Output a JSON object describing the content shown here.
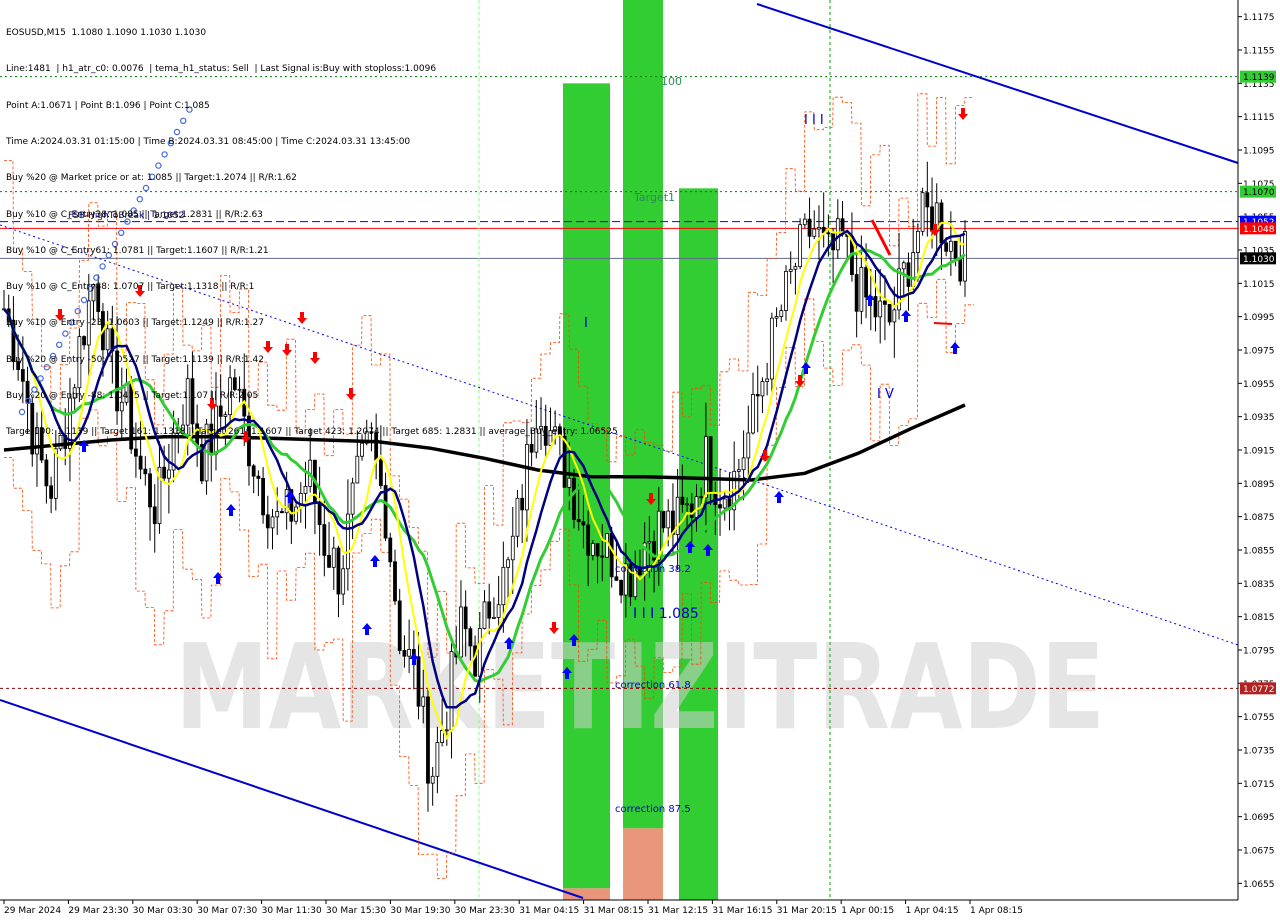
{
  "header": {
    "symbol_line": "EOSUSD,M15  1.1080 1.1090 1.1030 1.1030",
    "info_lines": [
      "Line:1481  | h1_atr_c0: 0.0076  | tema_h1_status: Sell  | Last Signal is:Buy with stoploss:1.0096",
      "Point A:1.0671 | Point B:1.096 | Point C:1.085",
      "Time A:2024.03.31 01:15:00 | Time B:2024.03.31 08:45:00 | Time C:2024.03.31 13:45:00",
      "Buy %20 @ Market price or at: 1.085 || Target:1.2074 || R/R:1.62",
      "Buy %10 @ C_Entry38: 1.085 || Target:1.2831 || R/R:2.63",
      "Buy %10 @ C_Entry61: 1.0781 || Target:1.1607 || R/R:1.21",
      "Buy %10 @ C_Entry88: 1.0707 || Target:1.1318 || R/R:1",
      "Buy %10 @ Entry -23: 1.0603 || Target:1.1249 || R/R:1.27",
      "Buy %20 @ Entry -50: 1.0527 || Target:1.1139 || R/R:1.42",
      "Buy %20 @ Entry -88: 1.0415 || Target:1.107 || R/R:2.05",
      "Target100: 1.1139 || Target 161: 1.1318 || Target 261: 1.1607 || Target 423: 1.2074 || Target 685: 1.2831 || average_Buy_entry: 1.06525"
    ]
  },
  "colors": {
    "background": "#ffffff",
    "candle": "#000000",
    "ma_black": "#000000",
    "ma_navy": "#000080",
    "ma_green": "#32cd32",
    "ma_yellow": "#ffff00",
    "channel": "#0000cd",
    "zone_green": "#32cd32",
    "zone_orange": "#e9967a",
    "dotted_green": "#008000",
    "price_label_green": "#32cd32",
    "price_label_blue": "#0000ff",
    "price_label_red": "#ff0000",
    "price_label_dark": "#000000",
    "label_dark_red": "#b22222",
    "arrow_up": "#0000ff",
    "arrow_down": "#ff0000",
    "orange_line": "#ff4500",
    "watermark": "#d0d0d0"
  },
  "price_axis": {
    "ticks": [
      "1.1175",
      "1.1155",
      "1.1135",
      "1.1115",
      "1.1095",
      "1.1075",
      "1.1055",
      "1.1035",
      "1.1015",
      "1.0995",
      "1.0975",
      "1.0955",
      "1.0935",
      "1.0915",
      "1.0895",
      "1.0875",
      "1.0855",
      "1.0835",
      "1.0815",
      "1.0795",
      "1.0775",
      "1.0755",
      "1.0735",
      "1.0715",
      "1.0695",
      "1.0675",
      "1.0655"
    ]
  },
  "time_axis": {
    "labels": [
      "29 Mar 2024",
      "29 Mar 23:30",
      "30 Mar 03:30",
      "30 Mar 07:30",
      "30 Mar 11:30",
      "30 Mar 15:30",
      "30 Mar 19:30",
      "30 Mar 23:30",
      "31 Mar 04:15",
      "31 Mar 08:15",
      "31 Mar 12:15",
      "31 Mar 16:15",
      "31 Mar 20:15",
      "1 Apr 00:15",
      "1 Apr 04:15",
      "1 Apr 08:15"
    ]
  },
  "price_labels": [
    {
      "value": "1.1139",
      "style": "green"
    },
    {
      "value": "1.1070",
      "style": "green"
    },
    {
      "value": "1.1052",
      "style": "blue"
    },
    {
      "value": "1.1048",
      "style": "red"
    },
    {
      "value": "1.1030",
      "style": "dark"
    },
    {
      "value": "1.0772",
      "style": "darkred"
    }
  ],
  "levels": [
    {
      "price": 1.1139,
      "style": "dotted_green"
    },
    {
      "price": 1.107,
      "style": "dotted_green"
    },
    {
      "price": 1.1052,
      "style": "dashed_blue"
    },
    {
      "price": 1.1048,
      "style": "solid_red"
    },
    {
      "price": 1.103,
      "style": "solid_slate"
    },
    {
      "price": 1.0772,
      "style": "dotted_darkred"
    }
  ],
  "annotations": {
    "fsb_label": "FSB-HighToBreak | 1.1052",
    "target1": "Target1",
    "hundred": "100",
    "wave_iii": "I I I",
    "wave_i": "I",
    "wave_iv": "I V",
    "wave_iii_price": "I I I 1.085",
    "correction_38": "correction 38.2",
    "correction_61": "correction 61.8",
    "correction_87": "correction 87.5",
    "watermark": "MARKETIZITRADE"
  },
  "chart_data": {
    "type": "candlestick",
    "symbol": "EOSUSD",
    "timeframe": "M15",
    "ohlc_last": {
      "open": 1.108,
      "high": 1.109,
      "low": 1.103,
      "close": 1.103
    },
    "ylim": [
      1.0645,
      1.1185
    ],
    "grid": false,
    "x_categories": [
      "29 Mar 2024",
      "29 Mar 23:30",
      "30 Mar 03:30",
      "30 Mar 07:30",
      "30 Mar 11:30",
      "30 Mar 15:30",
      "30 Mar 19:30",
      "30 Mar 23:30",
      "31 Mar 04:15",
      "31 Mar 08:15",
      "31 Mar 12:15",
      "31 Mar 16:15",
      "31 Mar 20:15",
      "1 Apr 00:15",
      "1 Apr 04:15",
      "1 Apr 08:15"
    ],
    "close_path": [
      1.1,
      1.097,
      1.092,
      1.089,
      1.093,
      1.098,
      1.102,
      1.096,
      1.094,
      1.09,
      1.088,
      1.092,
      1.095,
      1.091,
      1.093,
      1.096,
      1.092,
      1.089,
      1.087,
      1.088,
      1.09,
      1.086,
      1.084,
      1.089,
      1.092,
      1.088,
      1.08,
      1.078,
      1.072,
      1.076,
      1.081,
      1.079,
      1.083,
      1.084,
      1.089,
      1.095,
      1.092,
      1.09,
      1.087,
      1.086,
      1.085,
      1.084,
      1.086,
      1.087,
      1.087,
      1.088,
      1.091,
      1.089,
      1.09,
      1.093,
      1.097,
      1.1,
      1.103,
      1.105,
      1.103,
      1.104,
      1.101,
      1.1,
      1.099,
      1.102,
      1.105,
      1.106,
      1.104,
      1.103
    ],
    "sma_long": [
      1.0915,
      1.0918,
      1.0921,
      1.0923,
      1.0923,
      1.0922,
      1.0921,
      1.092,
      1.0916,
      1.091,
      1.0903,
      1.0899,
      1.0899,
      1.0898,
      1.0897,
      1.0901,
      1.0913,
      1.0928,
      1.0942
    ],
    "levels": [
      1.1139,
      1.107,
      1.1052,
      1.1048,
      1.103,
      1.0772
    ],
    "points": {
      "A": 1.0671,
      "B": 1.096,
      "C": 1.085
    },
    "targets": {
      "100": 1.1139,
      "161": 1.1318,
      "261": 1.1607,
      "423": 1.2074,
      "685": 1.2831
    },
    "entries": [
      1.085,
      1.0781,
      1.0707,
      1.0603,
      1.0527,
      1.0415
    ],
    "average_buy_entry": 1.06525,
    "stoploss": 1.0096,
    "zones": [
      {
        "label": "correction 38.2",
        "color": "green"
      },
      {
        "label": "correction 61.8",
        "color": "green"
      },
      {
        "label": "correction 87.5",
        "color": "green"
      }
    ]
  }
}
